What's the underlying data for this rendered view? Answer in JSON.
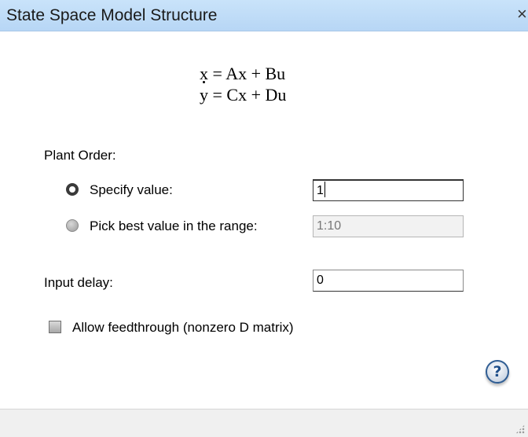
{
  "window": {
    "title": "State Space Model Structure",
    "close_glyph": "×"
  },
  "equation": {
    "line1_rest": "x = Ax + Bu",
    "line2": "y = Cx + Du"
  },
  "plant_order": {
    "label": "Plant Order:",
    "specify": {
      "label": "Specify value:",
      "selected": true,
      "value": "1"
    },
    "pick_best": {
      "label": "Pick best value in the range:",
      "selected": false,
      "value": "1:10"
    }
  },
  "input_delay": {
    "label": "Input delay:",
    "value": "0"
  },
  "feedthrough": {
    "label": "Allow feedthrough (nonzero D matrix)",
    "checked": false
  },
  "help": {
    "glyph": "?",
    "icon": "help-icon"
  }
}
